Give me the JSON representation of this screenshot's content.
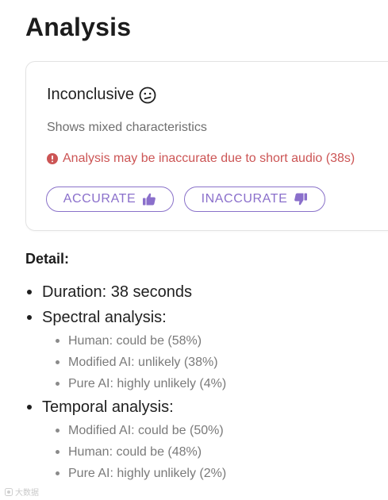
{
  "header": {
    "title": "Analysis"
  },
  "result_card": {
    "verdict": "Inconclusive",
    "verdict_icon": "confused-face-icon",
    "summary": "Shows mixed characteristics",
    "warning": "Analysis may be inaccurate due to short audio (38s)",
    "warning_icon": "alert-circle-icon",
    "accurate_label": "ACCURATE",
    "accurate_icon": "thumbs-up-icon",
    "inaccurate_label": "INACCURATE",
    "inaccurate_icon": "thumbs-down-icon"
  },
  "detail": {
    "heading": "Detail:",
    "duration": "Duration: 38 seconds",
    "spectral": {
      "label": "Spectral analysis:",
      "items": [
        "Human: could be (58%)",
        "Modified AI: unlikely (38%)",
        "Pure AI: highly unlikely (4%)"
      ]
    },
    "temporal": {
      "label": "Temporal analysis:",
      "items": [
        "Modified AI: could be (50%)",
        "Human: could be (48%)",
        "Pure AI: highly unlikely (2%)"
      ]
    }
  },
  "watermark": {
    "text": "大数据"
  },
  "colors": {
    "accent": "#8a6fcb",
    "warning": "#cc5555",
    "muted_text": "#6f6f6f",
    "card_border": "#e3e3e3"
  }
}
